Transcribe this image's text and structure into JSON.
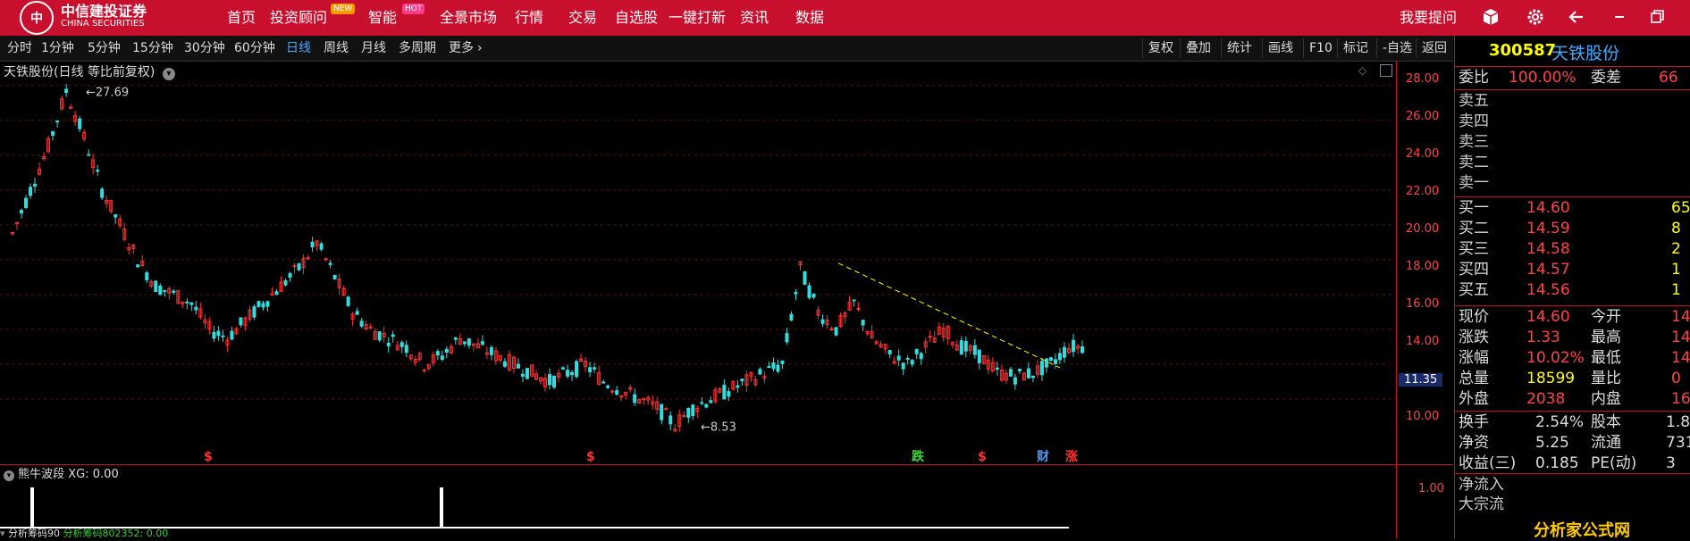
{
  "header": {
    "logo_cn": "中信建投证券",
    "logo_en": "CHINA SECURITIES",
    "nav": [
      {
        "label": "首页"
      },
      {
        "label": "投资顾问",
        "badge": "NEW"
      },
      {
        "label": "智能",
        "badge": "HOT"
      },
      {
        "label": "全景市场"
      },
      {
        "label": "行情"
      },
      {
        "label": "交易"
      },
      {
        "label": "自选股"
      },
      {
        "label": "一键打新"
      },
      {
        "label": "资讯"
      },
      {
        "label": "数据"
      }
    ],
    "ask": "我要提问",
    "icons": [
      "cube-icon",
      "gear-icon",
      "back-arrow-icon",
      "minimize-icon",
      "restore-icon"
    ]
  },
  "toolbar": {
    "periods": [
      "分时",
      "1分钟",
      "5分钟",
      "15分钟",
      "30分钟",
      "60分钟",
      "日线",
      "周线",
      "月线",
      "多周期",
      "更多"
    ],
    "active": "日线",
    "right_buttons": [
      "复权",
      "叠加",
      "统计",
      "画线",
      "F10",
      "标记",
      "-自选",
      "返回"
    ]
  },
  "chart": {
    "title": "天铁股份(日线 等比前复权)",
    "yaxis": [
      "28.00",
      "26.00",
      "24.00",
      "22.00",
      "20.00",
      "18.00",
      "16.00",
      "14.00",
      "12.00",
      "10.00"
    ],
    "current_label": "11.35",
    "high_label": "27.69",
    "low_label": "8.53",
    "signals": [
      {
        "text": "$",
        "color": "#ff3333"
      },
      {
        "text": "$",
        "color": "#ff3333"
      },
      {
        "text": "跌",
        "color": "#33dd33"
      },
      {
        "text": "$",
        "color": "#ff3333"
      },
      {
        "text": "财",
        "color": "#4499ff"
      },
      {
        "text": "涨",
        "color": "#ff3333"
      }
    ]
  },
  "sub_chart": {
    "title": "熊牛波段 XG: 0.00",
    "yval": "1.00",
    "bottom_label_1": "分析筹码90",
    "bottom_label_2": "分析筹码802352: 0.00"
  },
  "chart_data": {
    "type": "candlestick",
    "title": "天铁股份(日线 等比前复权)",
    "ylim": [
      8,
      28.5
    ],
    "series": [
      {
        "name": "天铁股份",
        "values": [
          19.5,
          22,
          24.5,
          27.69,
          25,
          22,
          20,
          18,
          16.5,
          16,
          15.5,
          14,
          13.5,
          14.5,
          15.5,
          16.5,
          17.5,
          19,
          17,
          15,
          14,
          13.5,
          13,
          12,
          12.5,
          13.5,
          13,
          12.5,
          12,
          11.5,
          11,
          11.5,
          12,
          11,
          10.5,
          10,
          9.5,
          8.53,
          9.5,
          10,
          10.5,
          11,
          11.5,
          12,
          17.5,
          15,
          14,
          15.5,
          13.5,
          12.5,
          12,
          13,
          14,
          13,
          12.5,
          11.5,
          11.3,
          11.5,
          12,
          13
        ]
      }
    ],
    "annotations": [
      "27.69",
      "8.53"
    ]
  },
  "quote": {
    "code": "300587",
    "name": "天铁股份",
    "weibi_label": "委比",
    "weibi": "100.00%",
    "weicha_label": "委差",
    "weicha": "66",
    "sells": [
      "卖五",
      "卖四",
      "卖三",
      "卖二",
      "卖一"
    ],
    "buys": [
      {
        "label": "买一",
        "price": "14.60",
        "vol": "65"
      },
      {
        "label": "买二",
        "price": "14.59",
        "vol": "8"
      },
      {
        "label": "买三",
        "price": "14.58",
        "vol": "2"
      },
      {
        "label": "买四",
        "price": "14.57",
        "vol": "1"
      },
      {
        "label": "买五",
        "price": "14.56",
        "vol": "1"
      }
    ],
    "stats": [
      {
        "l1": "现价",
        "v1": "14.60",
        "c1": "red",
        "l2": "今开",
        "v2": "14"
      },
      {
        "l1": "涨跌",
        "v1": "1.33",
        "c1": "red",
        "l2": "最高",
        "v2": "14"
      },
      {
        "l1": "涨幅",
        "v1": "10.02%",
        "c1": "red",
        "l2": "最低",
        "v2": "14"
      },
      {
        "l1": "总量",
        "v1": "18599",
        "c1": "yel",
        "l2": "量比",
        "v2": "0"
      },
      {
        "l1": "外盘",
        "v1": "2038",
        "c1": "red",
        "l2": "内盘",
        "v2": "16"
      }
    ],
    "stats2": [
      {
        "l1": "换手",
        "v1": "2.54%",
        "l2": "股本",
        "v2": "1.8"
      },
      {
        "l1": "净资",
        "v1": "5.25",
        "l2": "流通",
        "v2": "731"
      },
      {
        "l1": "收益(三)",
        "v1": "0.185",
        "l2": "PE(动)",
        "v2": "3"
      }
    ],
    "flows": [
      "净流入",
      "大宗流"
    ]
  },
  "watermark": "分析家公式网"
}
